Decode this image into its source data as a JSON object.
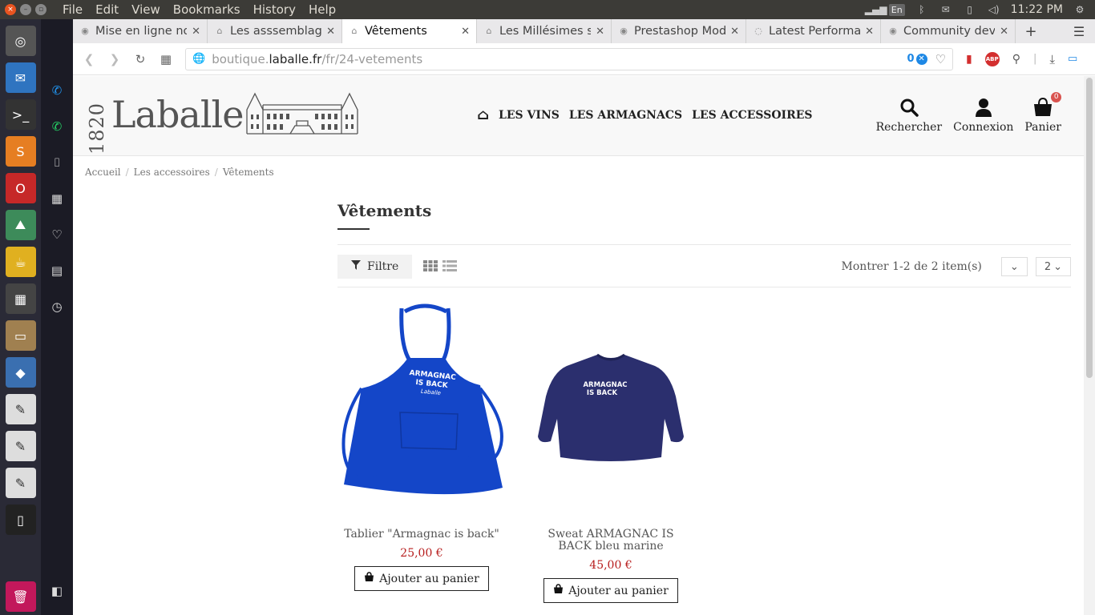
{
  "system": {
    "menus": [
      "File",
      "Edit",
      "View",
      "Bookmarks",
      "History",
      "Help"
    ],
    "lang": "En",
    "clock": "11:22 PM"
  },
  "tabs": [
    {
      "title": "Mise en ligne no",
      "icon": "prestashop-icon",
      "active": false
    },
    {
      "title": "Les asssemblage",
      "icon": "laballe-icon",
      "active": false
    },
    {
      "title": "Vêtements",
      "icon": "laballe-icon",
      "active": true
    },
    {
      "title": "Les Millésimes s",
      "icon": "laballe-icon",
      "active": false
    },
    {
      "title": "Prestashop Mod",
      "icon": "prestashop-icon",
      "active": false
    },
    {
      "title": "Latest Performa",
      "icon": "loading-icon",
      "active": false
    },
    {
      "title": "Community deve",
      "icon": "prestashop-icon",
      "active": false
    }
  ],
  "address": {
    "prefix": "boutique.",
    "domain": "laballe.fr",
    "path": "/fr/24-vetements",
    "badge_count": "0"
  },
  "site": {
    "logo_year": "1820",
    "logo_name": "Laballe",
    "nav": [
      "LES VINS",
      "LES ARMAGNACS",
      "LES ACCESSOIRES"
    ],
    "search_label": "Rechercher",
    "login_label": "Connexion",
    "cart_label": "Panier",
    "cart_count": "0"
  },
  "breadcrumb": [
    "Accueil",
    "Les accessoires",
    "Vêtements"
  ],
  "category": {
    "title": "Vêtements",
    "filter_label": "Filtre",
    "showing": "Montrer 1-2 de 2 item(s)",
    "sort_value": "",
    "per_page": "2"
  },
  "products": [
    {
      "name": "Tablier \"Armagnac is back\"",
      "price": "25,00 €",
      "button": "Ajouter au panier",
      "image_text": [
        "ARMAGNAC",
        "IS BACK",
        "Laballe"
      ]
    },
    {
      "name": "Sweat ARMAGNAC IS BACK bleu marine",
      "price": "45,00 €",
      "button": "Ajouter au panier",
      "image_text": [
        "ARMAGNAC",
        "IS BACK"
      ]
    }
  ],
  "colors": {
    "accent_price": "#b71c1c",
    "apron": "#1446c8",
    "sweat": "#2b2f6e"
  }
}
